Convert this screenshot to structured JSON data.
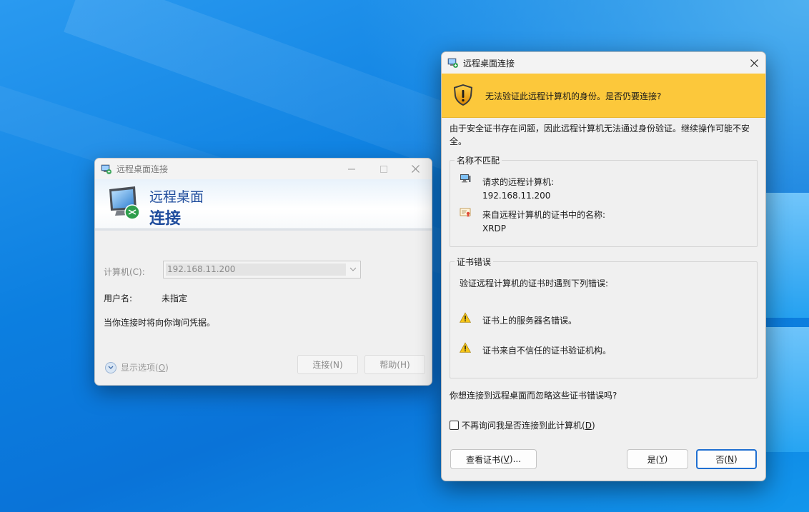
{
  "rdc_window": {
    "title": "远程桌面连接",
    "banner_line1": "远程桌面",
    "banner_line2": "连接",
    "computer_label": "计算机(C):",
    "computer_value": "192.168.11.200",
    "user_label": "用户名:",
    "user_value": "未指定",
    "note": "当你连接时将向你询问凭据。",
    "show_options_prefix": "显示选项(",
    "show_options_key": "O",
    "show_options_suffix": ")",
    "connect_button": "连接(N)",
    "help_button": "帮助(H)"
  },
  "cert_dialog": {
    "title": "远程桌面连接",
    "warning": "无法验证此远程计算机的身份。是否仍要连接?",
    "intro": "由于安全证书存在问题，因此远程计算机无法通过身份验证。继续操作可能不安全。",
    "group1": {
      "legend": "名称不匹配",
      "requested_label": "请求的远程计算机:",
      "requested_value": "192.168.11.200",
      "cert_name_label": "来自远程计算机的证书中的名称:",
      "cert_name_value": "XRDP"
    },
    "group2": {
      "legend": "证书错误",
      "heading": "验证远程计算机的证书时遇到下列错误:",
      "errors": [
        "证书上的服务器名错误。",
        "证书来自不信任的证书验证机构。"
      ]
    },
    "question": "你想连接到远程桌面而忽略这些证书错误吗?",
    "checkbox_prefix": "不再询问我是否连接到此计算机(",
    "checkbox_key": "D",
    "checkbox_suffix": ")",
    "view_cert_prefix": "查看证书(",
    "view_cert_key": "V",
    "view_cert_suffix": ")...",
    "yes_prefix": "是(",
    "yes_key": "Y",
    "yes_suffix": ")",
    "no_prefix": "否(",
    "no_key": "N",
    "no_suffix": ")"
  },
  "icons": [
    "rdc-app-icon",
    "minimize-icon",
    "maximize-icon",
    "close-icon",
    "monitor-icon",
    "chevron-down-icon",
    "expand-options-icon",
    "shield-warning-icon",
    "computer-icon",
    "certificate-icon",
    "warning-icon"
  ],
  "colors": {
    "warning_bar": "#fcc83b",
    "banner_text": "#1f4c9c",
    "default_button_border": "#1f6fd1",
    "desktop": "#0a73d8"
  }
}
